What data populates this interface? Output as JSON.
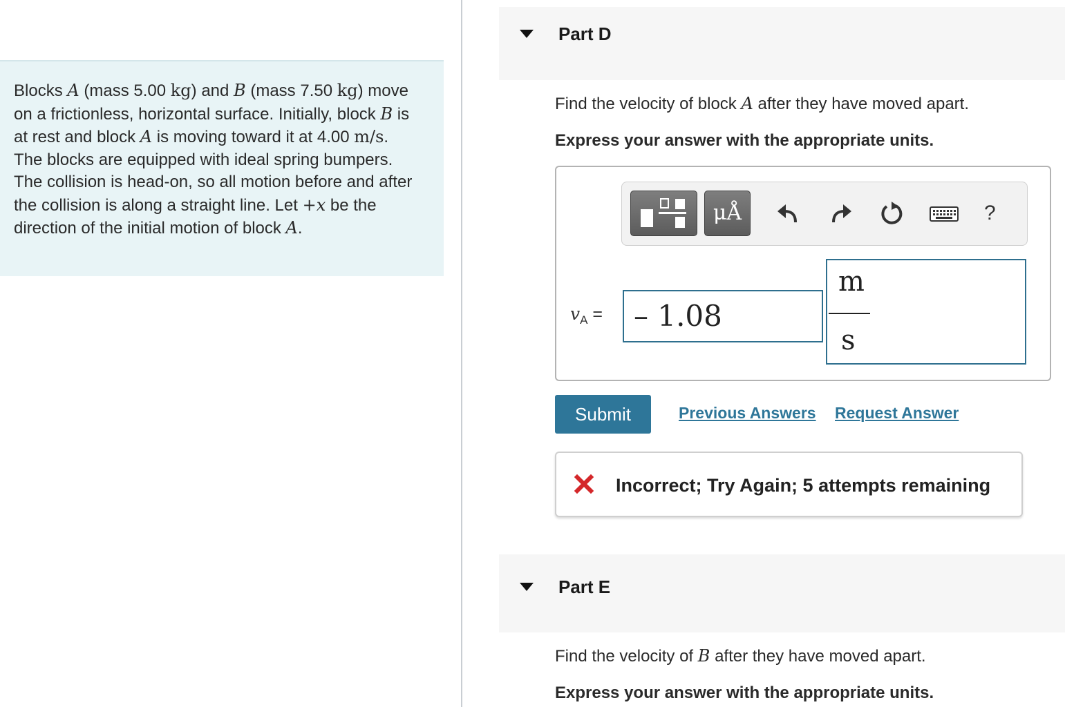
{
  "problem": {
    "t1": "Blocks ",
    "a": "A",
    "t2": " (mass 5.00 ",
    "kg": "kg",
    "t3": ") and ",
    "b": "B",
    "t4": " (mass 7.50 ",
    "t5": ") move on a frictionless, horizontal surface. Initially, block ",
    "t6": " is at rest and block ",
    "t7": " is moving toward it at 4.00 ",
    "ms": "m/s",
    "t8": ". The blocks are equipped with ideal spring bumpers. The collision is head-on, so all motion before and after the collision is along a straight line. Let ",
    "plusx": "+x",
    "t9": " be the direction of the initial motion of block ",
    "t10": "."
  },
  "partD": {
    "title": "Part D",
    "q_pre": "Find the velocity of block ",
    "q_var": "A",
    "q_post": " after they have moved apart.",
    "instruction": "Express your answer with the appropriate units.",
    "toolbar": {
      "units_label": "μÅ",
      "icons": [
        "templates-icon",
        "units-icon",
        "undo-icon",
        "redo-icon",
        "reset-icon",
        "keyboard-icon",
        "help-icon"
      ],
      "help_label": "?"
    },
    "variable": "v",
    "variable_sub": "A",
    "equals": "=",
    "value": "– 1.08",
    "unit_numerator": "m",
    "unit_denominator": "s",
    "submit_label": "Submit",
    "previous_answers_label": "Previous Answers",
    "request_answer_label": "Request Answer",
    "feedback": "Incorrect; Try Again; 5 attempts remaining",
    "feedback_color": "#d4272a"
  },
  "partE": {
    "title": "Part E",
    "q_pre": "Find the velocity of ",
    "q_var": "B",
    "q_post": " after they have moved apart.",
    "instruction": "Express your answer with the appropriate units."
  },
  "colors": {
    "accent": "#2e7699",
    "problem_bg": "#e8f4f6",
    "input_border": "#2e6f8e"
  }
}
